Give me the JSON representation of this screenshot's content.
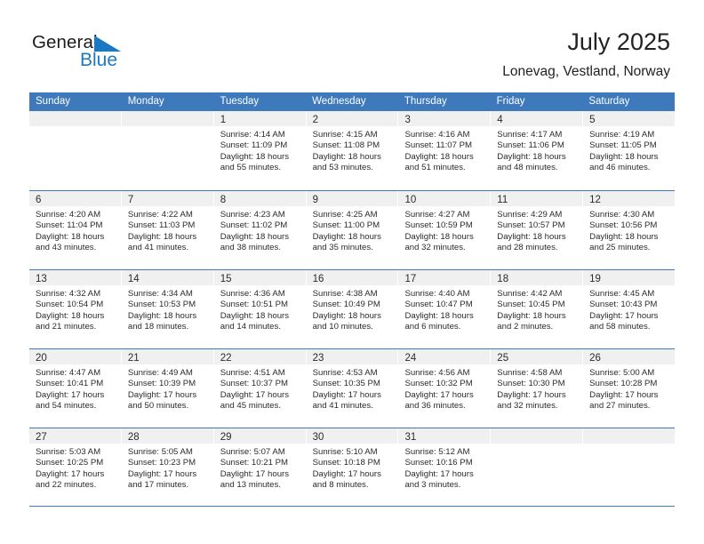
{
  "brand": {
    "name_part1": "General",
    "name_part2": "Blue",
    "accent_color": "#1b79c4",
    "header_color": "#3e79bc"
  },
  "header": {
    "title": "July 2025",
    "subtitle": "Lonevag, Vestland, Norway"
  },
  "weekday_headers": [
    "Sunday",
    "Monday",
    "Tuesday",
    "Wednesday",
    "Thursday",
    "Friday",
    "Saturday"
  ],
  "weeks": [
    [
      {
        "day": "",
        "lines": []
      },
      {
        "day": "",
        "lines": []
      },
      {
        "day": "1",
        "lines": [
          "Sunrise: 4:14 AM",
          "Sunset: 11:09 PM",
          "Daylight: 18 hours",
          "and 55 minutes."
        ]
      },
      {
        "day": "2",
        "lines": [
          "Sunrise: 4:15 AM",
          "Sunset: 11:08 PM",
          "Daylight: 18 hours",
          "and 53 minutes."
        ]
      },
      {
        "day": "3",
        "lines": [
          "Sunrise: 4:16 AM",
          "Sunset: 11:07 PM",
          "Daylight: 18 hours",
          "and 51 minutes."
        ]
      },
      {
        "day": "4",
        "lines": [
          "Sunrise: 4:17 AM",
          "Sunset: 11:06 PM",
          "Daylight: 18 hours",
          "and 48 minutes."
        ]
      },
      {
        "day": "5",
        "lines": [
          "Sunrise: 4:19 AM",
          "Sunset: 11:05 PM",
          "Daylight: 18 hours",
          "and 46 minutes."
        ]
      }
    ],
    [
      {
        "day": "6",
        "lines": [
          "Sunrise: 4:20 AM",
          "Sunset: 11:04 PM",
          "Daylight: 18 hours",
          "and 43 minutes."
        ]
      },
      {
        "day": "7",
        "lines": [
          "Sunrise: 4:22 AM",
          "Sunset: 11:03 PM",
          "Daylight: 18 hours",
          "and 41 minutes."
        ]
      },
      {
        "day": "8",
        "lines": [
          "Sunrise: 4:23 AM",
          "Sunset: 11:02 PM",
          "Daylight: 18 hours",
          "and 38 minutes."
        ]
      },
      {
        "day": "9",
        "lines": [
          "Sunrise: 4:25 AM",
          "Sunset: 11:00 PM",
          "Daylight: 18 hours",
          "and 35 minutes."
        ]
      },
      {
        "day": "10",
        "lines": [
          "Sunrise: 4:27 AM",
          "Sunset: 10:59 PM",
          "Daylight: 18 hours",
          "and 32 minutes."
        ]
      },
      {
        "day": "11",
        "lines": [
          "Sunrise: 4:29 AM",
          "Sunset: 10:57 PM",
          "Daylight: 18 hours",
          "and 28 minutes."
        ]
      },
      {
        "day": "12",
        "lines": [
          "Sunrise: 4:30 AM",
          "Sunset: 10:56 PM",
          "Daylight: 18 hours",
          "and 25 minutes."
        ]
      }
    ],
    [
      {
        "day": "13",
        "lines": [
          "Sunrise: 4:32 AM",
          "Sunset: 10:54 PM",
          "Daylight: 18 hours",
          "and 21 minutes."
        ]
      },
      {
        "day": "14",
        "lines": [
          "Sunrise: 4:34 AM",
          "Sunset: 10:53 PM",
          "Daylight: 18 hours",
          "and 18 minutes."
        ]
      },
      {
        "day": "15",
        "lines": [
          "Sunrise: 4:36 AM",
          "Sunset: 10:51 PM",
          "Daylight: 18 hours",
          "and 14 minutes."
        ]
      },
      {
        "day": "16",
        "lines": [
          "Sunrise: 4:38 AM",
          "Sunset: 10:49 PM",
          "Daylight: 18 hours",
          "and 10 minutes."
        ]
      },
      {
        "day": "17",
        "lines": [
          "Sunrise: 4:40 AM",
          "Sunset: 10:47 PM",
          "Daylight: 18 hours",
          "and 6 minutes."
        ]
      },
      {
        "day": "18",
        "lines": [
          "Sunrise: 4:42 AM",
          "Sunset: 10:45 PM",
          "Daylight: 18 hours",
          "and 2 minutes."
        ]
      },
      {
        "day": "19",
        "lines": [
          "Sunrise: 4:45 AM",
          "Sunset: 10:43 PM",
          "Daylight: 17 hours",
          "and 58 minutes."
        ]
      }
    ],
    [
      {
        "day": "20",
        "lines": [
          "Sunrise: 4:47 AM",
          "Sunset: 10:41 PM",
          "Daylight: 17 hours",
          "and 54 minutes."
        ]
      },
      {
        "day": "21",
        "lines": [
          "Sunrise: 4:49 AM",
          "Sunset: 10:39 PM",
          "Daylight: 17 hours",
          "and 50 minutes."
        ]
      },
      {
        "day": "22",
        "lines": [
          "Sunrise: 4:51 AM",
          "Sunset: 10:37 PM",
          "Daylight: 17 hours",
          "and 45 minutes."
        ]
      },
      {
        "day": "23",
        "lines": [
          "Sunrise: 4:53 AM",
          "Sunset: 10:35 PM",
          "Daylight: 17 hours",
          "and 41 minutes."
        ]
      },
      {
        "day": "24",
        "lines": [
          "Sunrise: 4:56 AM",
          "Sunset: 10:32 PM",
          "Daylight: 17 hours",
          "and 36 minutes."
        ]
      },
      {
        "day": "25",
        "lines": [
          "Sunrise: 4:58 AM",
          "Sunset: 10:30 PM",
          "Daylight: 17 hours",
          "and 32 minutes."
        ]
      },
      {
        "day": "26",
        "lines": [
          "Sunrise: 5:00 AM",
          "Sunset: 10:28 PM",
          "Daylight: 17 hours",
          "and 27 minutes."
        ]
      }
    ],
    [
      {
        "day": "27",
        "lines": [
          "Sunrise: 5:03 AM",
          "Sunset: 10:25 PM",
          "Daylight: 17 hours",
          "and 22 minutes."
        ]
      },
      {
        "day": "28",
        "lines": [
          "Sunrise: 5:05 AM",
          "Sunset: 10:23 PM",
          "Daylight: 17 hours",
          "and 17 minutes."
        ]
      },
      {
        "day": "29",
        "lines": [
          "Sunrise: 5:07 AM",
          "Sunset: 10:21 PM",
          "Daylight: 17 hours",
          "and 13 minutes."
        ]
      },
      {
        "day": "30",
        "lines": [
          "Sunrise: 5:10 AM",
          "Sunset: 10:18 PM",
          "Daylight: 17 hours",
          "and 8 minutes."
        ]
      },
      {
        "day": "31",
        "lines": [
          "Sunrise: 5:12 AM",
          "Sunset: 10:16 PM",
          "Daylight: 17 hours",
          "and 3 minutes."
        ]
      },
      {
        "day": "",
        "lines": []
      },
      {
        "day": "",
        "lines": []
      }
    ]
  ]
}
